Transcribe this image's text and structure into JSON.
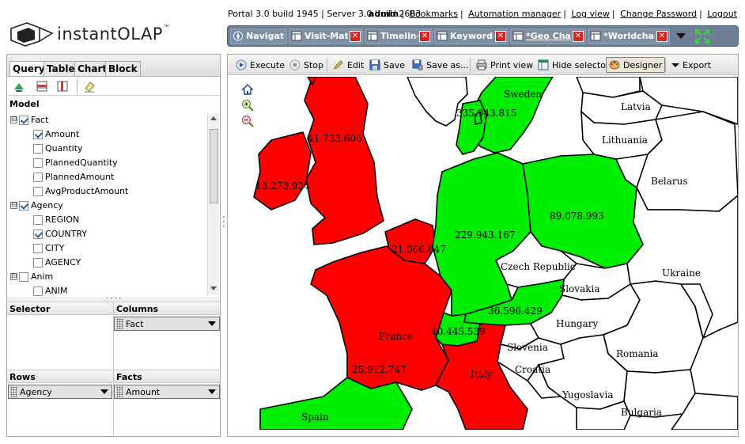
{
  "header": {
    "logo_text": "instantOLAP",
    "trademark": "™",
    "build_info": "Portal 3.0 build 1945 | Server 3.0 build 2683",
    "user": "admin",
    "links": [
      "Bookmarks",
      "Automation manager",
      "Log view",
      "Change Password",
      "Logout"
    ]
  },
  "tabs": [
    {
      "label": "Navigator",
      "closable": false,
      "active": false
    },
    {
      "label": "Visit-Matri",
      "closable": true,
      "active": false
    },
    {
      "label": "Timeline",
      "closable": true,
      "active": false
    },
    {
      "label": "Keyword-A",
      "closable": true,
      "active": false
    },
    {
      "label": "*Geo Chart",
      "closable": true,
      "active": true
    },
    {
      "label": "*Worldchart",
      "closable": true,
      "active": false
    }
  ],
  "close_glyph": "✕",
  "left": {
    "query_tabs": [
      "Query",
      "Table",
      "Chart",
      "Block"
    ],
    "model_label": "Model",
    "tree": [
      {
        "label": "Fact",
        "level": 0,
        "expander": "⊟",
        "checked": true
      },
      {
        "label": "Amount",
        "level": 1,
        "checked": true
      },
      {
        "label": "Quantity",
        "level": 1,
        "checked": false
      },
      {
        "label": "PlannedQuantity",
        "level": 1,
        "checked": false
      },
      {
        "label": "PlannedAmount",
        "level": 1,
        "checked": false
      },
      {
        "label": "AvgProductAmount",
        "level": 1,
        "checked": false
      },
      {
        "label": "Agency",
        "level": 0,
        "expander": "⊟",
        "checked": true
      },
      {
        "label": "REGION",
        "level": 1,
        "checked": false
      },
      {
        "label": "COUNTRY",
        "level": 1,
        "checked": true
      },
      {
        "label": "CITY",
        "level": 1,
        "checked": false
      },
      {
        "label": "AGENCY",
        "level": 1,
        "checked": false
      },
      {
        "label": "Anim",
        "level": 0,
        "expander": "⊟",
        "checked": false
      },
      {
        "label": "ANIM",
        "level": 1,
        "checked": false
      }
    ],
    "zones": {
      "selector": {
        "title": "Selector"
      },
      "columns": {
        "title": "Columns",
        "chip": "Fact"
      },
      "rows": {
        "title": "Rows",
        "chip": "Agency"
      },
      "facts": {
        "title": "Facts",
        "chip": "Amount"
      }
    }
  },
  "toolbar": {
    "execute": "Execute",
    "stop": "Stop",
    "edit": "Edit",
    "save": "Save",
    "save_as": "Save as...",
    "print_view": "Print view",
    "hide_selector": "Hide selector",
    "designer": "Designer",
    "export": "Export"
  },
  "map": {
    "colors": {
      "high": "#00ee00",
      "low": "#ff0000",
      "none": "#ffffff"
    },
    "countries": [
      {
        "name": "Sweden",
        "value": "335.943.815",
        "fill": "high"
      },
      {
        "name": "Latvia",
        "value": "",
        "fill": "none"
      },
      {
        "name": "Lithuania",
        "value": "",
        "fill": "none"
      },
      {
        "name": "Belarus",
        "value": "",
        "fill": "none"
      },
      {
        "name": "",
        "value": "41.733.606",
        "fill": "low"
      },
      {
        "name": "",
        "value": "13.273.924",
        "fill": "low"
      },
      {
        "name": "",
        "value": "89.078.993",
        "fill": "high"
      },
      {
        "name": "",
        "value": "229.943.167",
        "fill": "high"
      },
      {
        "name": "",
        "value": "21.066.847",
        "fill": "low"
      },
      {
        "name": "Ukraine",
        "value": "",
        "fill": "none"
      },
      {
        "name": "Czech Republic",
        "value": "",
        "fill": "none"
      },
      {
        "name": "Slovakia",
        "value": "",
        "fill": "none"
      },
      {
        "name": "",
        "value": "36.596.429",
        "fill": "high"
      },
      {
        "name": "Hungary",
        "value": "",
        "fill": "none"
      },
      {
        "name": "",
        "value": "40.445.539",
        "fill": "high"
      },
      {
        "name": "France",
        "value": "",
        "fill": "low"
      },
      {
        "name": "Slovenia",
        "value": "",
        "fill": "none"
      },
      {
        "name": "Romania",
        "value": "",
        "fill": "none"
      },
      {
        "name": "Croatia",
        "value": "",
        "fill": "none"
      },
      {
        "name": "",
        "value": "25.912.747",
        "fill": "low"
      },
      {
        "name": "Italy",
        "value": "",
        "fill": "low"
      },
      {
        "name": "Yugoslavia",
        "value": "",
        "fill": "none"
      },
      {
        "name": "Bulgaria",
        "value": "",
        "fill": "none"
      },
      {
        "name": "Spain",
        "value": "",
        "fill": "high"
      }
    ]
  }
}
